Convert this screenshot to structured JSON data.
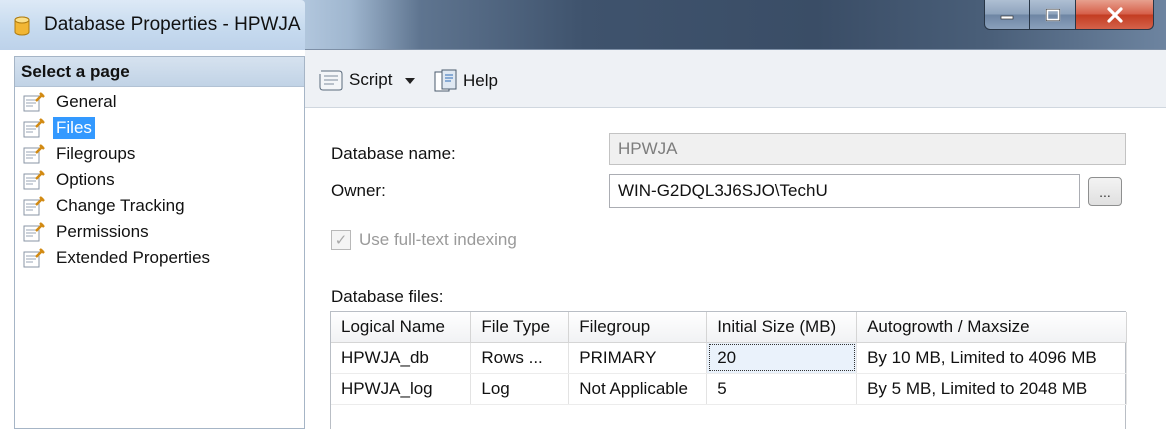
{
  "window": {
    "title": "Database Properties - HPWJA",
    "controls": [
      "minimize",
      "maximize",
      "close"
    ]
  },
  "left_pane": {
    "heading": "Select a page",
    "items": [
      {
        "label": "General",
        "icon": "page-wrench-icon",
        "selected": false
      },
      {
        "label": "Files",
        "icon": "page-wrench-icon",
        "selected": true
      },
      {
        "label": "Filegroups",
        "icon": "page-wrench-icon",
        "selected": false
      },
      {
        "label": "Options",
        "icon": "page-wrench-icon",
        "selected": false
      },
      {
        "label": "Change Tracking",
        "icon": "page-wrench-icon",
        "selected": false
      },
      {
        "label": "Permissions",
        "icon": "page-wrench-icon",
        "selected": false
      },
      {
        "label": "Extended Properties",
        "icon": "page-wrench-icon",
        "selected": false
      }
    ]
  },
  "toolbar": {
    "script_label": "Script",
    "help_label": "Help"
  },
  "form": {
    "database_name_label": "Database name:",
    "database_name_value": "HPWJA",
    "owner_label": "Owner:",
    "owner_value": "WIN-G2DQL3J6SJO\\TechU",
    "owner_browse_label": "...",
    "fulltext_label": "Use full-text indexing",
    "fulltext_checked": true,
    "database_files_label": "Database files:"
  },
  "files_grid": {
    "columns": [
      "Logical Name",
      "File Type",
      "Filegroup",
      "Initial Size (MB)",
      "Autogrowth / Maxsize"
    ],
    "rows": [
      [
        "HPWJA_db",
        "Rows ...",
        "PRIMARY",
        "20",
        "By 10 MB, Limited to 4096 MB"
      ],
      [
        "HPWJA_log",
        "Log",
        "Not Applicable",
        "5",
        "By 5 MB, Limited to 2048 MB"
      ]
    ]
  },
  "colors": {
    "selection": "#3399ff",
    "titlebar_dark": "#3f536d",
    "close_button": "#c33d22"
  }
}
